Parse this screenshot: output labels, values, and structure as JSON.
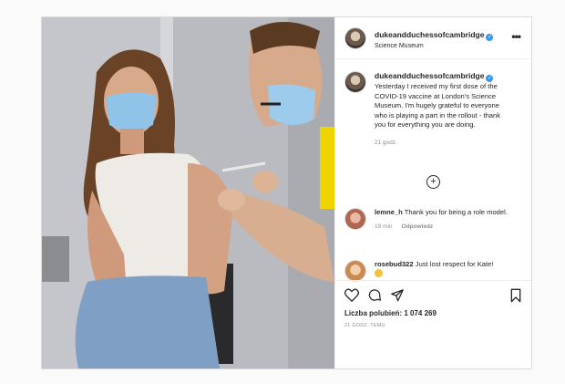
{
  "post": {
    "username": "dukeandduchessofcambridge",
    "location": "Science Museum",
    "caption": "Yesterday I received my first dose of the COVID-19 vaccine at London's Science Museum. I'm hugely grateful to everyone who is playing a part in the rollout - thank you for everything you are doing.",
    "caption_time": "21 godz.",
    "likes_label": "Liczba polubień:",
    "likes_count": "1 074 269",
    "posted_ago": "21 GODZ. TEMU"
  },
  "comments": [
    {
      "username": "lemne_h",
      "text": "Thank you for being a role model.",
      "time": "19 min",
      "reply": "Odpowiedz"
    },
    {
      "username": "rosebud322",
      "text": "Just lost respect for Kate!"
    }
  ],
  "icons": {
    "verified": "verified-badge-icon",
    "more": "more-options-icon",
    "load_more": "plus-circle-icon",
    "like": "heart-icon",
    "comment": "comment-icon",
    "share": "paper-plane-icon",
    "save": "bookmark-icon"
  },
  "colors": {
    "accent": "#3897f0",
    "muted": "#8e8e8e",
    "text": "#262626"
  }
}
